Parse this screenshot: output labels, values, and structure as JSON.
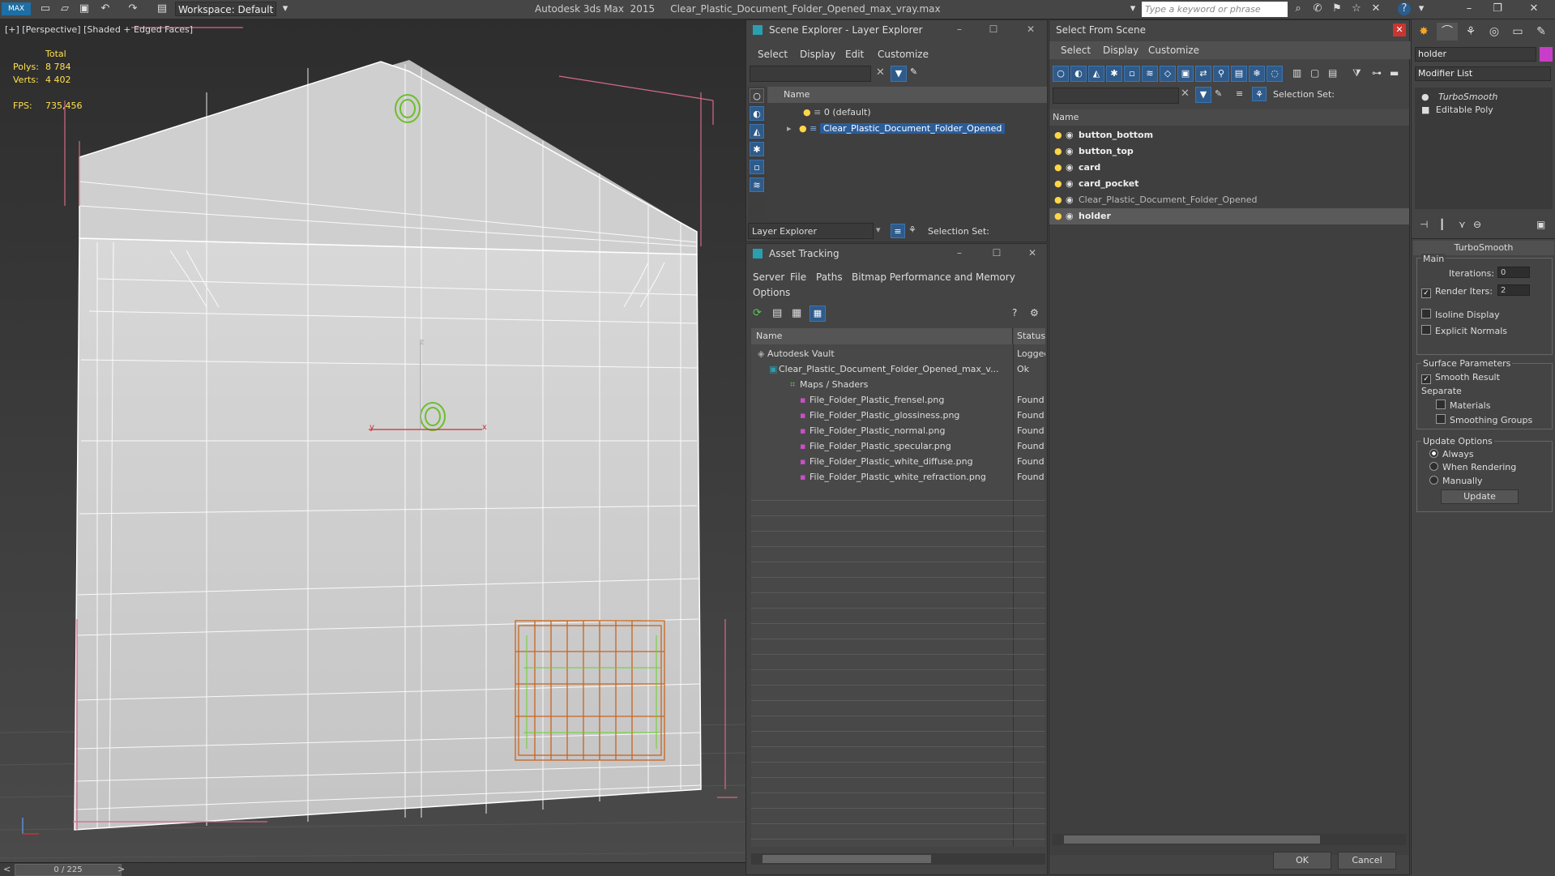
{
  "titlebar": {
    "workspace": "Workspace: Default",
    "app_title": "Autodesk 3ds Max  2015     Clear_Plastic_Document_Folder_Opened_max_vray.max",
    "search_placeholder": "Type a keyword or phrase"
  },
  "viewport": {
    "label": "[+] [Perspective] [Shaded + Edged Faces]",
    "stats": {
      "total_label": "Total",
      "polys_label": "Polys:",
      "polys_value": "8 784",
      "verts_label": "Verts:",
      "verts_value": "4 402",
      "fps_label": "FPS:",
      "fps_value": "735,456"
    },
    "axis_z": "z",
    "axis_x": "x",
    "axis_y": "y",
    "timeline": "0 / 225"
  },
  "scene_explorer": {
    "title": "Scene Explorer - Layer Explorer",
    "menus": [
      "Select",
      "Display",
      "Edit",
      "Customize"
    ],
    "column_name": "Name",
    "layers": [
      "0 (default)",
      "Clear_Plastic_Document_Folder_Opened"
    ],
    "footer_dropdown": "Layer Explorer",
    "selection_set_label": "Selection Set:"
  },
  "asset_tracking": {
    "title": "Asset Tracking",
    "menus": [
      "Server",
      "File",
      "Paths",
      "Bitmap Performance and Memory",
      "Options"
    ],
    "col_name": "Name",
    "col_status": "Status",
    "rows": [
      {
        "name": "Autodesk Vault",
        "status": "Logged"
      },
      {
        "name": "Clear_Plastic_Document_Folder_Opened_max_v...",
        "status": "Ok"
      },
      {
        "name": "Maps / Shaders",
        "status": ""
      },
      {
        "name": "File_Folder_Plastic_frensel.png",
        "status": "Found"
      },
      {
        "name": "File_Folder_Plastic_glossiness.png",
        "status": "Found"
      },
      {
        "name": "File_Folder_Plastic_normal.png",
        "status": "Found"
      },
      {
        "name": "File_Folder_Plastic_specular.png",
        "status": "Found"
      },
      {
        "name": "File_Folder_Plastic_white_diffuse.png",
        "status": "Found"
      },
      {
        "name": "File_Folder_Plastic_white_refraction.png",
        "status": "Found"
      }
    ]
  },
  "select_from_scene": {
    "title": "Select From Scene",
    "menus": [
      "Select",
      "Display",
      "Customize"
    ],
    "selection_set_label": "Selection Set:",
    "column_name": "Name",
    "objects": [
      "button_bottom",
      "button_top",
      "card",
      "card_pocket",
      "Clear_Plastic_Document_Folder_Opened",
      "holder"
    ],
    "ok_label": "OK",
    "cancel_label": "Cancel"
  },
  "command_panel": {
    "object_name": "holder",
    "modifier_list": "Modifier List",
    "stack": [
      "TurboSmooth",
      "Editable Poly"
    ],
    "rollout_title": "TurboSmooth",
    "main_label": "Main",
    "iterations_label": "Iterations:",
    "iterations_value": "0",
    "render_iters_label": "Render Iters:",
    "render_iters_value": "2",
    "isoline_label": "Isoline Display",
    "explicit_normals_label": "Explicit Normals",
    "surface_params_label": "Surface Parameters",
    "smooth_result_label": "Smooth Result",
    "separate_label": "Separate",
    "materials_label": "Materials",
    "smoothing_groups_label": "Smoothing Groups",
    "update_options_label": "Update Options",
    "always_label": "Always",
    "when_rendering_label": "When Rendering",
    "manually_label": "Manually",
    "update_button": "Update"
  }
}
